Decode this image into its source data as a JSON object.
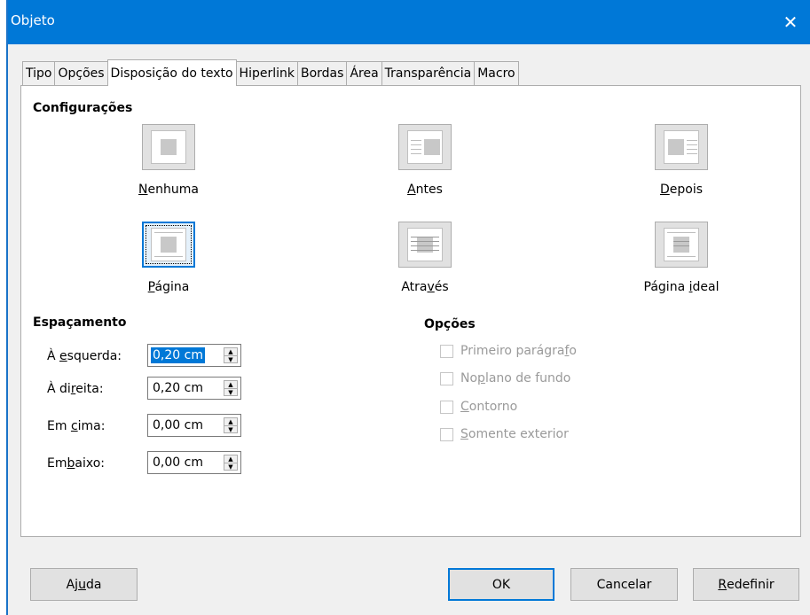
{
  "window": {
    "title": "Objeto",
    "close_glyph": "✕"
  },
  "tabs": [
    {
      "label": "Tipo",
      "active": false
    },
    {
      "label": "Opções",
      "active": false
    },
    {
      "label": "Disposição do texto",
      "active": true
    },
    {
      "label": "Hiperlink",
      "active": false
    },
    {
      "label": "Bordas",
      "active": false
    },
    {
      "label": "Área",
      "active": false
    },
    {
      "label": "Transparência",
      "active": false
    },
    {
      "label": "Macro",
      "active": false
    }
  ],
  "settings": {
    "title": "Configurações",
    "options": [
      {
        "pre": "",
        "key": "N",
        "post": "enhuma",
        "icon": "wrap-none-icon"
      },
      {
        "pre": "",
        "key": "A",
        "post": "ntes",
        "icon": "wrap-before-icon"
      },
      {
        "pre": "",
        "key": "D",
        "post": "epois",
        "icon": "wrap-after-icon"
      },
      {
        "pre": "",
        "key": "P",
        "post": "ágina",
        "icon": "wrap-parallel-icon",
        "selected": true
      },
      {
        "pre": "Atra",
        "key": "v",
        "post": "és",
        "icon": "wrap-through-icon"
      },
      {
        "pre": "Página ",
        "key": "i",
        "post": "deal",
        "icon": "wrap-optimal-icon"
      }
    ]
  },
  "spacing": {
    "title": "Espaçamento",
    "rows": [
      {
        "pre": "À ",
        "key": "e",
        "post": "squerda:",
        "value": "0,20 cm",
        "selected": true
      },
      {
        "pre": "À di",
        "key": "r",
        "post": "eita:",
        "value": "0,20 cm"
      },
      {
        "pre": "Em ",
        "key": "c",
        "post": "ima:",
        "value": "0,00 cm"
      },
      {
        "pre": "Em",
        "key": "b",
        "post": "aixo:",
        "value": "0,00 cm"
      }
    ]
  },
  "options": {
    "title": "Opções",
    "items": [
      {
        "pre": "Primeiro parágra",
        "key": "f",
        "post": "o"
      },
      {
        "pre": "No ",
        "key": "p",
        "post": "lano de fundo"
      },
      {
        "pre": "",
        "key": "C",
        "post": "ontorno"
      },
      {
        "pre": "",
        "key": "S",
        "post": "omente exterior"
      }
    ]
  },
  "buttons": {
    "help": {
      "pre": "Aj",
      "key": "u",
      "post": "da"
    },
    "ok": "OK",
    "cancel": "Cancelar",
    "reset": {
      "pre": "",
      "key": "R",
      "post": "edefinir"
    }
  }
}
